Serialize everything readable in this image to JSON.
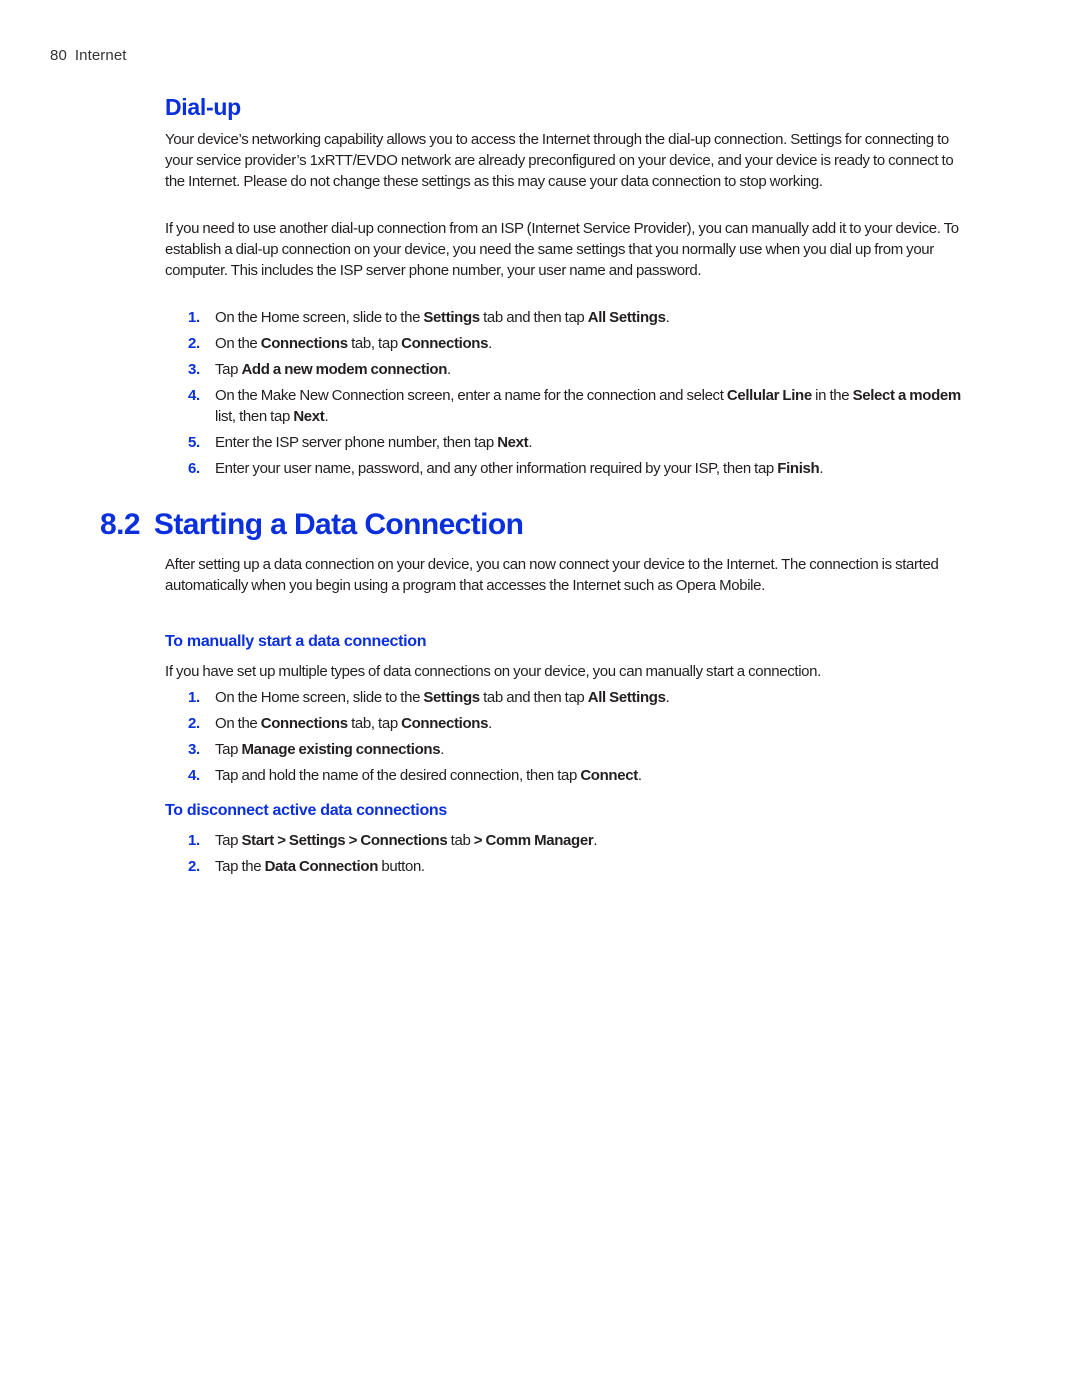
{
  "header": {
    "page_number": "80",
    "section": "Internet"
  },
  "dialup": {
    "title": "Dial-up",
    "para1": "Your device’s networking capability allows you to access the Internet through the dial-up connection. Settings for connecting to your service provider’s 1xRTT/EVDO network are already preconfigured on your device, and your device is ready to connect to the Internet. Please do not change these settings as this may cause your data connection to stop working.",
    "para2": "If you need to use another dial-up connection from an ISP (Internet Service Provider), you can manually add it to your device. To establish a dial-up connection on your device, you need the same settings that you normally use when you dial up from your computer. This includes the ISP server phone number, your user name and password.",
    "steps": [
      {
        "n": "1.",
        "parts": [
          [
            "On the Home screen, slide to the ",
            false
          ],
          [
            "Settings",
            true
          ],
          [
            " tab and then tap ",
            false
          ],
          [
            "All Settings",
            true
          ],
          [
            ".",
            false
          ]
        ]
      },
      {
        "n": "2.",
        "parts": [
          [
            "On the ",
            false
          ],
          [
            "Connections",
            true
          ],
          [
            " tab, tap ",
            false
          ],
          [
            "Connections",
            true
          ],
          [
            ".",
            false
          ]
        ]
      },
      {
        "n": "3.",
        "parts": [
          [
            "Tap ",
            false
          ],
          [
            "Add a new modem connection",
            true
          ],
          [
            ".",
            false
          ]
        ]
      },
      {
        "n": "4.",
        "parts": [
          [
            "On the Make New Connection screen, enter a name for the connection and select ",
            false
          ],
          [
            "Cellular Line",
            true
          ],
          [
            " in the ",
            false
          ],
          [
            "Select a modem",
            true
          ],
          [
            " list, then tap ",
            false
          ],
          [
            "Next",
            true
          ],
          [
            ".",
            false
          ]
        ]
      },
      {
        "n": "5.",
        "parts": [
          [
            "Enter the ISP server phone number, then tap ",
            false
          ],
          [
            "Next",
            true
          ],
          [
            ".",
            false
          ]
        ]
      },
      {
        "n": "6.",
        "parts": [
          [
            "Enter your user name, password, and any other information required by your ISP, then tap ",
            false
          ],
          [
            "Finish",
            true
          ],
          [
            ".",
            false
          ]
        ]
      }
    ]
  },
  "section": {
    "number": "8.2",
    "title": "Starting a Data Connection",
    "intro": "After setting up a data connection on your device, you can now connect your device to the Internet. The connection is started automatically when you begin using a program that accesses the Internet such as Opera Mobile."
  },
  "manual_start": {
    "title": "To manually start a data connection",
    "intro": "If you have set up multiple types of data connections on your device, you can manually start a connection.",
    "steps": [
      {
        "n": "1.",
        "parts": [
          [
            "On the Home screen, slide to the ",
            false
          ],
          [
            "Settings",
            true
          ],
          [
            " tab and then tap ",
            false
          ],
          [
            "All Settings",
            true
          ],
          [
            ".",
            false
          ]
        ]
      },
      {
        "n": "2.",
        "parts": [
          [
            "On the ",
            false
          ],
          [
            "Connections",
            true
          ],
          [
            " tab, tap ",
            false
          ],
          [
            "Connections",
            true
          ],
          [
            ".",
            false
          ]
        ]
      },
      {
        "n": "3.",
        "parts": [
          [
            "Tap ",
            false
          ],
          [
            "Manage existing connections",
            true
          ],
          [
            ".",
            false
          ]
        ]
      },
      {
        "n": "4.",
        "parts": [
          [
            "Tap and hold the name of the desired connection, then tap ",
            false
          ],
          [
            "Connect",
            true
          ],
          [
            ".",
            false
          ]
        ]
      }
    ]
  },
  "disconnect": {
    "title": "To disconnect active data connections",
    "steps": [
      {
        "n": "1.",
        "parts": [
          [
            "Tap ",
            false
          ],
          [
            "Start > Settings > Connections",
            true
          ],
          [
            " tab ",
            false
          ],
          [
            "> Comm Manager",
            true
          ],
          [
            ".",
            false
          ]
        ]
      },
      {
        "n": "2.",
        "parts": [
          [
            "Tap the ",
            false
          ],
          [
            "Data Connection",
            true
          ],
          [
            " button.",
            false
          ]
        ]
      }
    ]
  },
  "colors": {
    "heading_blue": "#0a2fdc",
    "body_text": "#231f20"
  }
}
